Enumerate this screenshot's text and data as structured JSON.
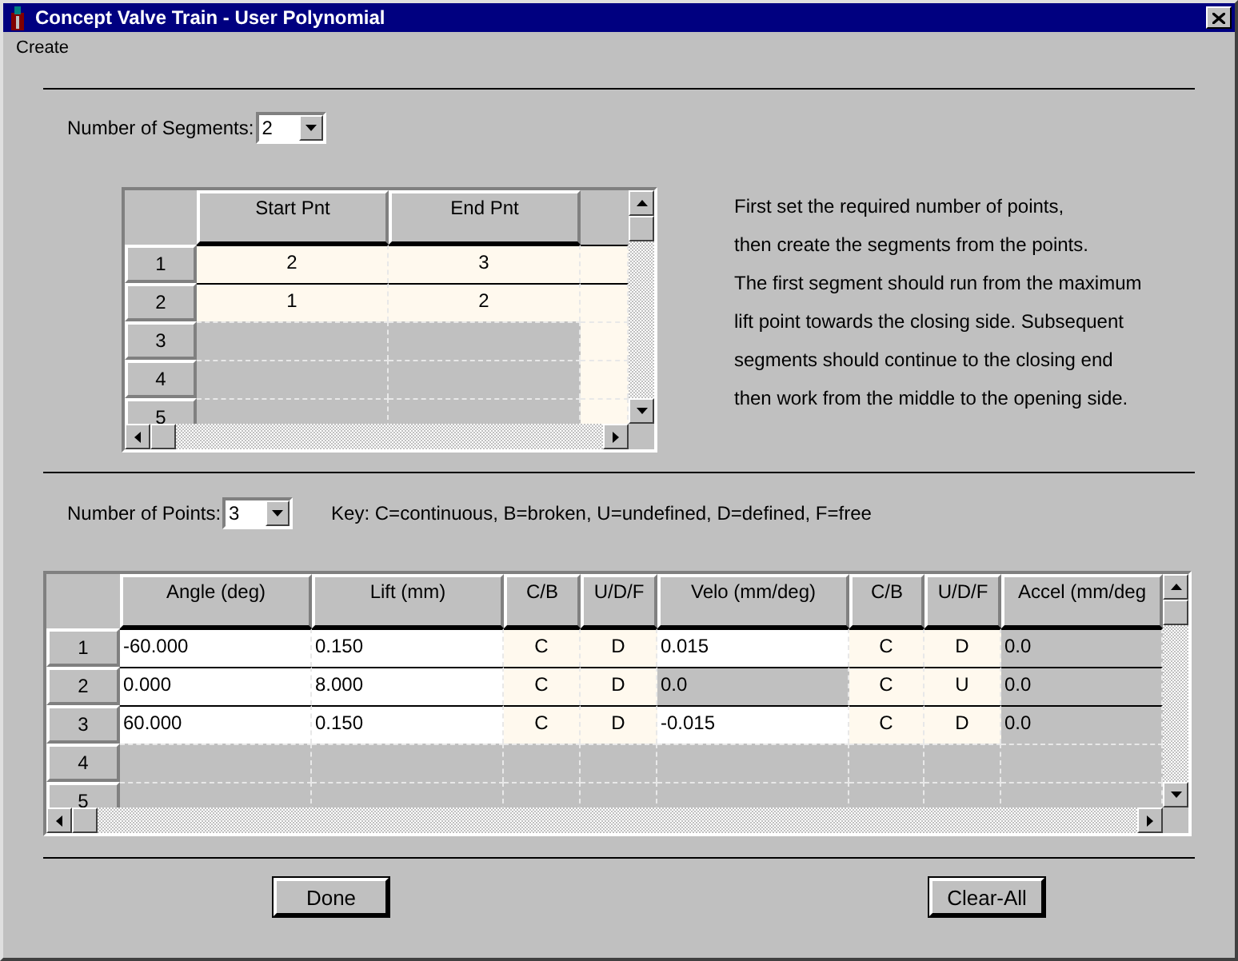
{
  "window": {
    "title": "Concept Valve Train - User Polynomial"
  },
  "menu": [
    "Create"
  ],
  "segments": {
    "label": "Number of Segments:",
    "value": "2"
  },
  "segment_table": {
    "columns": [
      "Start Pnt",
      "End Pnt"
    ],
    "rows": [
      {
        "label": "1",
        "cells": [
          {
            "text": "2",
            "kind": "flag"
          },
          {
            "text": "3",
            "kind": "flag"
          }
        ]
      },
      {
        "label": "2",
        "cells": [
          {
            "text": "1",
            "kind": "flag"
          },
          {
            "text": "2",
            "kind": "flag"
          }
        ]
      },
      {
        "label": "3",
        "cells": [
          {
            "kind": "readonly"
          },
          {
            "kind": "readonly"
          }
        ]
      },
      {
        "label": "4",
        "cells": [
          {
            "kind": "readonly"
          },
          {
            "kind": "readonly"
          }
        ]
      },
      {
        "label": "5",
        "cells": [
          {
            "kind": "readonly"
          },
          {
            "kind": "readonly"
          }
        ]
      }
    ]
  },
  "instructions": [
    "First set the required number of points,",
    "then create the segments from the points.",
    "The first segment should run from the maximum",
    "lift point towards the closing side. Subsequent",
    "segments should continue to the closing end",
    "then work from the middle to the opening side."
  ],
  "points": {
    "label": "Number of Points:",
    "value": "3"
  },
  "key": "Key: C=continuous, B=broken, U=undefined, D=defined, F=free",
  "point_table": {
    "columns": [
      "Angle (deg)",
      "Lift (mm)",
      "C/B",
      "U/D/F",
      "Velo (mm/deg)",
      "C/B",
      "U/D/F",
      "Accel (mm/deg"
    ],
    "rows": [
      {
        "label": "1",
        "cells": [
          {
            "text": "-60.000",
            "kind": "input"
          },
          {
            "text": "0.150",
            "kind": "input"
          },
          {
            "text": "C",
            "kind": "flag"
          },
          {
            "text": "D",
            "kind": "flag"
          },
          {
            "text": "0.015",
            "kind": "input"
          },
          {
            "text": "C",
            "kind": "flag"
          },
          {
            "text": "D",
            "kind": "flag"
          },
          {
            "text": "0.0",
            "kind": "readonly"
          }
        ]
      },
      {
        "label": "2",
        "cells": [
          {
            "text": "0.000",
            "kind": "input"
          },
          {
            "text": "8.000",
            "kind": "input"
          },
          {
            "text": "C",
            "kind": "flag"
          },
          {
            "text": "D",
            "kind": "flag"
          },
          {
            "text": "0.0",
            "kind": "readonly"
          },
          {
            "text": "C",
            "kind": "flag"
          },
          {
            "text": "U",
            "kind": "flag"
          },
          {
            "text": "0.0",
            "kind": "readonly"
          }
        ]
      },
      {
        "label": "3",
        "cells": [
          {
            "text": "60.000",
            "kind": "input"
          },
          {
            "text": "0.150",
            "kind": "input"
          },
          {
            "text": "C",
            "kind": "flag"
          },
          {
            "text": "D",
            "kind": "flag"
          },
          {
            "text": "-0.015",
            "kind": "input"
          },
          {
            "text": "C",
            "kind": "flag"
          },
          {
            "text": "D",
            "kind": "flag"
          },
          {
            "text": "0.0",
            "kind": "readonly"
          }
        ]
      },
      {
        "label": "4",
        "cells": [
          {
            "kind": "readonly"
          },
          {
            "kind": "readonly"
          },
          {
            "kind": "readonly"
          },
          {
            "kind": "readonly"
          },
          {
            "kind": "readonly"
          },
          {
            "kind": "readonly"
          },
          {
            "kind": "readonly"
          },
          {
            "kind": "readonly"
          }
        ]
      },
      {
        "label": "5",
        "cells": [
          {
            "kind": "readonly"
          },
          {
            "kind": "readonly"
          },
          {
            "kind": "readonly"
          },
          {
            "kind": "readonly"
          },
          {
            "kind": "readonly"
          },
          {
            "kind": "readonly"
          },
          {
            "kind": "readonly"
          },
          {
            "kind": "readonly"
          }
        ]
      }
    ]
  },
  "buttons": [
    "Done",
    "Clear-All"
  ]
}
